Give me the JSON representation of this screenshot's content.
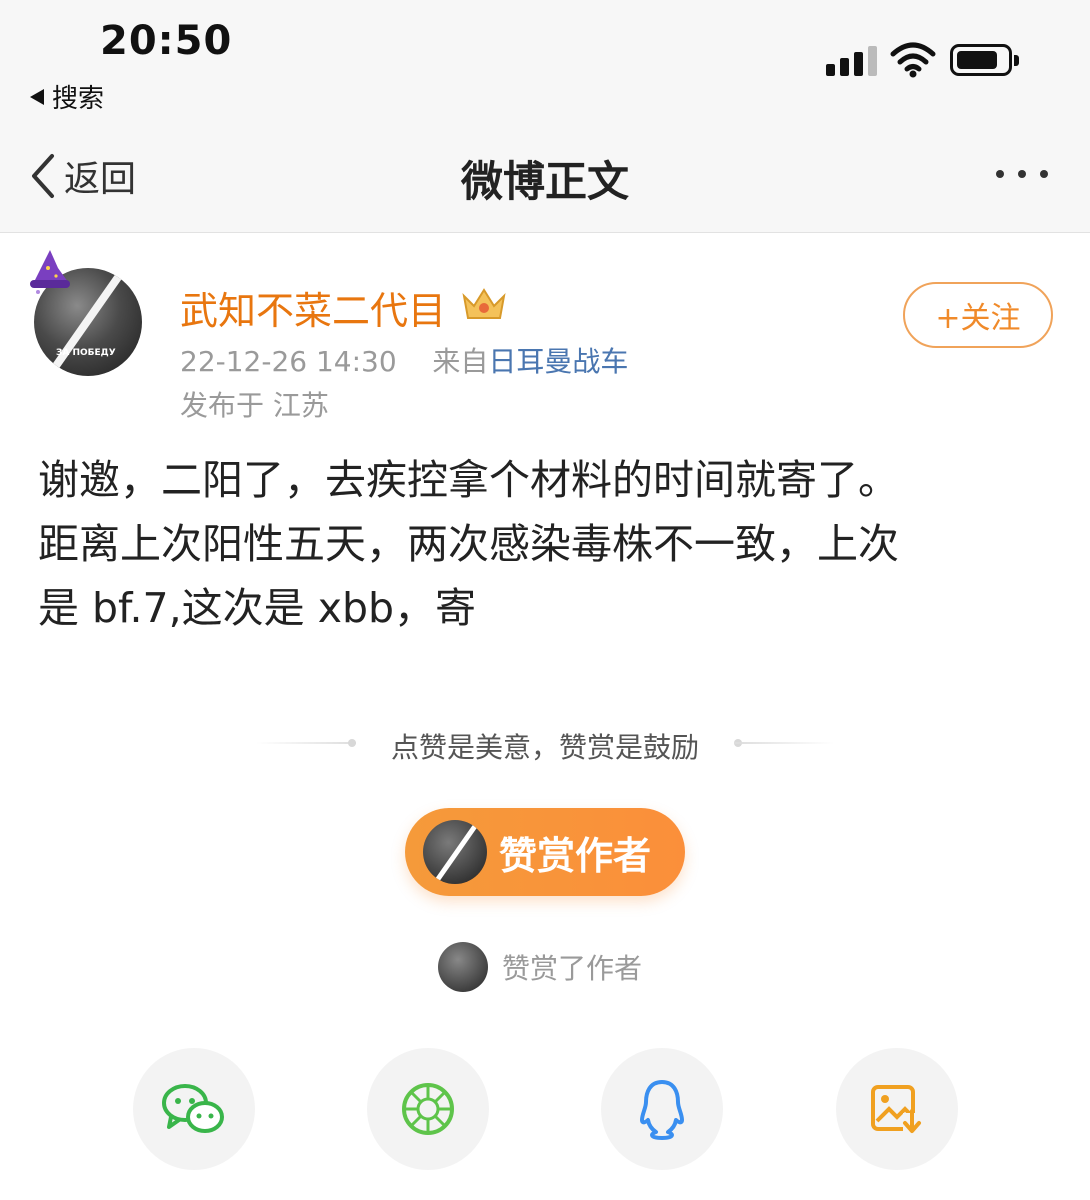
{
  "status_bar": {
    "time": "20:50",
    "back_app_label": "搜索"
  },
  "nav": {
    "back_label": "返回",
    "title": "微博正文"
  },
  "post": {
    "author": "武知不菜二代目",
    "timestamp": "22-12-26 14:30",
    "source_prefix": "来自",
    "source": "日耳曼战车",
    "location": "发布于 江苏",
    "follow_label": "+关注",
    "avatar_caption": "ЗА ПОБЕДУ",
    "content": "谢邀，二阳了，去疾控拿个材料的时间就寄了。\n距离上次阳性五天，两次感染毒株不一致，上次\n是 bf.7,这次是 xbb，寄"
  },
  "reward": {
    "tagline": "点赞是美意，赞赏是鼓励",
    "button_label": "赞赏作者",
    "rewarded_text": "赞赏了作者"
  },
  "share_icons": [
    {
      "name": "wechat-icon",
      "color": "#39b54a"
    },
    {
      "name": "moments-icon",
      "color": "#5ec44a"
    },
    {
      "name": "qq-icon",
      "color": "#3a8ff0"
    },
    {
      "name": "save-image-icon",
      "color": "#f0a020"
    }
  ],
  "colors": {
    "accent": "#e8760f",
    "link": "#4a76b0",
    "reward": "#f59a3a"
  }
}
